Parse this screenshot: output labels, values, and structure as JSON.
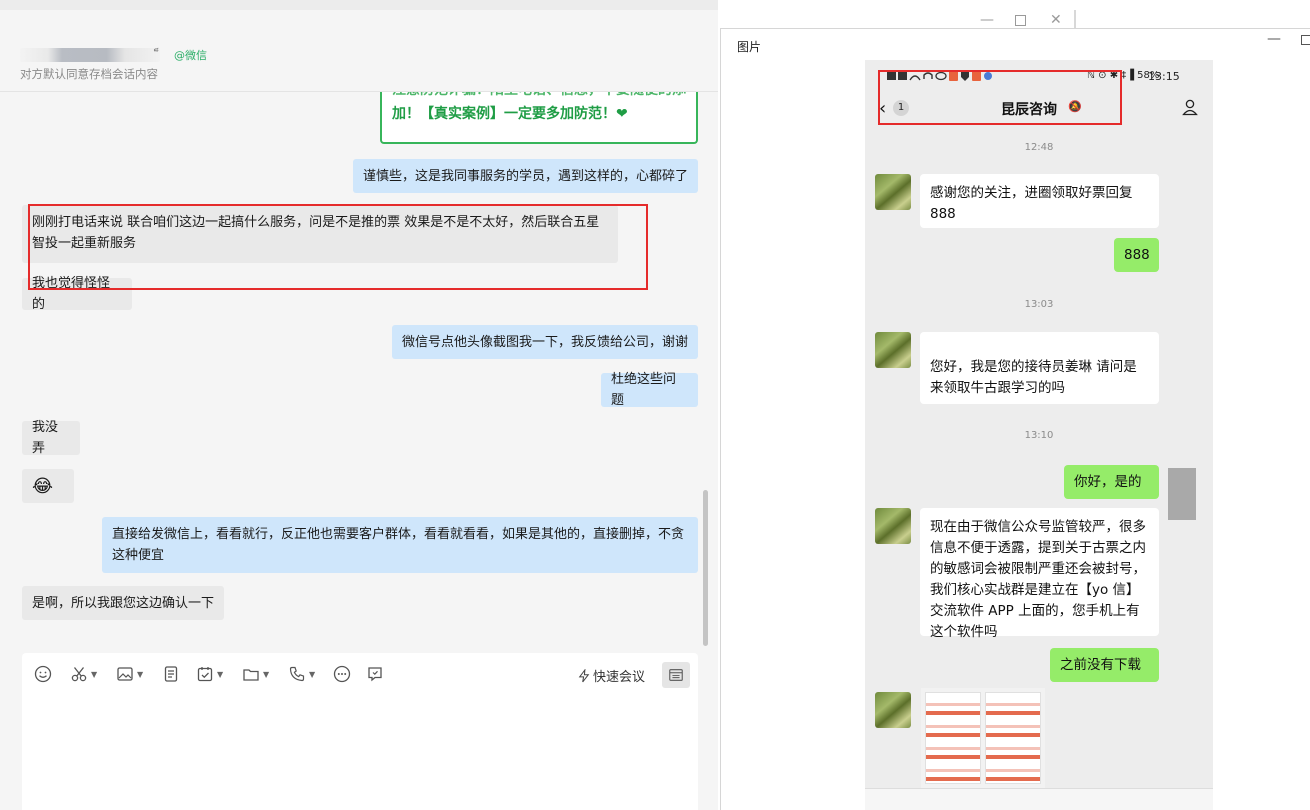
{
  "left": {
    "contact_suffix": "็",
    "wechat_tag": "@微信",
    "archive_note": "对方默认同意存档会话内容",
    "warning_card": {
      "line1": "注意防范诈骗！陌生电话、信息，不要随便的添",
      "line2": "加！【真实案例】一定要多加防范！❤"
    },
    "messages": [
      {
        "text": "谨慎些，这是我同事服务的学员，遇到这样的，心都碎了"
      },
      {
        "text": "刚刚打电话来说  联合咱们这边一起搞什么服务，问是不是推的票 效果是不是不太好，然后联合五星智投一起重新服务"
      },
      {
        "text": "我也觉得怪怪的"
      },
      {
        "text": "微信号点他头像截图我一下，我反馈给公司，谢谢"
      },
      {
        "text": "杜绝这些问题"
      },
      {
        "text": "我没弄"
      },
      {
        "text": "😂"
      },
      {
        "text": "直接给发微信上，看看就行，反正他也需要客户群体，看看就看看，如果是其他的，直接删掉，不贪这种便宜"
      },
      {
        "text": "是啊，所以我跟您这边确认一下"
      }
    ],
    "toolbar": {
      "icons": [
        "emoji-icon",
        "scissors-icon",
        "image-icon",
        "document-icon",
        "task-icon",
        "folder-icon",
        "phone-icon",
        "more-icon",
        "chat-record-icon"
      ],
      "quick_meeting_label": "快速会议"
    }
  },
  "viewer": {
    "title": "图片",
    "phone": {
      "status_right": "ℕ ⊙ ✱ ‡▐ 58%",
      "status_time": "13:15",
      "back_count": "1",
      "title": "昆辰咨询",
      "timestamps": [
        "12:48",
        "13:03",
        "13:10"
      ],
      "messages": [
        {
          "text": "感谢您的关注，进圈领取好票回复888"
        },
        {
          "text": "888"
        },
        {
          "text": "您好，我是您的接待员姜琳 请问是来领取牛古跟学习的吗"
        },
        {
          "text": "你好，是的"
        },
        {
          "text": "现在由于微信公众号监管较严，很多信息不便于透露，提到关于古票之内的敏感词会被限制严重还会被封号，我们核心实战群是建立在【yo 信】交流软件 APP 上面的，您手机上有这个软件吗"
        },
        {
          "text": "之前没有下载"
        }
      ]
    }
  }
}
